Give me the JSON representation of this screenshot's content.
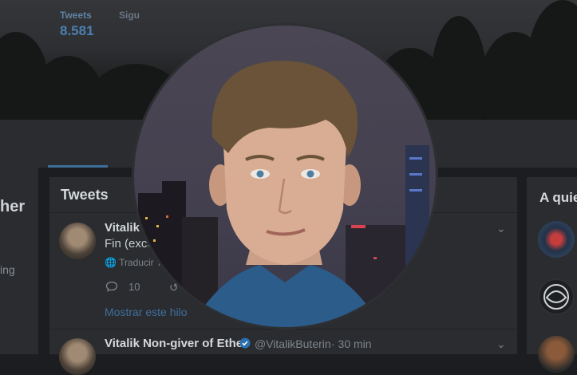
{
  "nav": {
    "tweets_label": "Tweets",
    "tweets_count": "8.581",
    "following_label": "Sigu"
  },
  "left": {
    "name_fragment": "her",
    "bio_fragment": "ing"
  },
  "feed": {
    "title": "Tweets",
    "tweets": [
      {
        "name": "Vitalik I",
        "text": "Fin (exce",
        "translate": "Traducir T",
        "reply_count": "10",
        "show_thread": "Mostrar este hilo"
      },
      {
        "name": "Vitalik Non-giver of Ether",
        "handle": "@VitalikButerin",
        "time": "· 30 min"
      }
    ]
  },
  "right": {
    "title": "A quie"
  },
  "colors": {
    "accent": "#4d7fb0",
    "link": "#3f6f9f",
    "verified": "#2a6fb0"
  }
}
